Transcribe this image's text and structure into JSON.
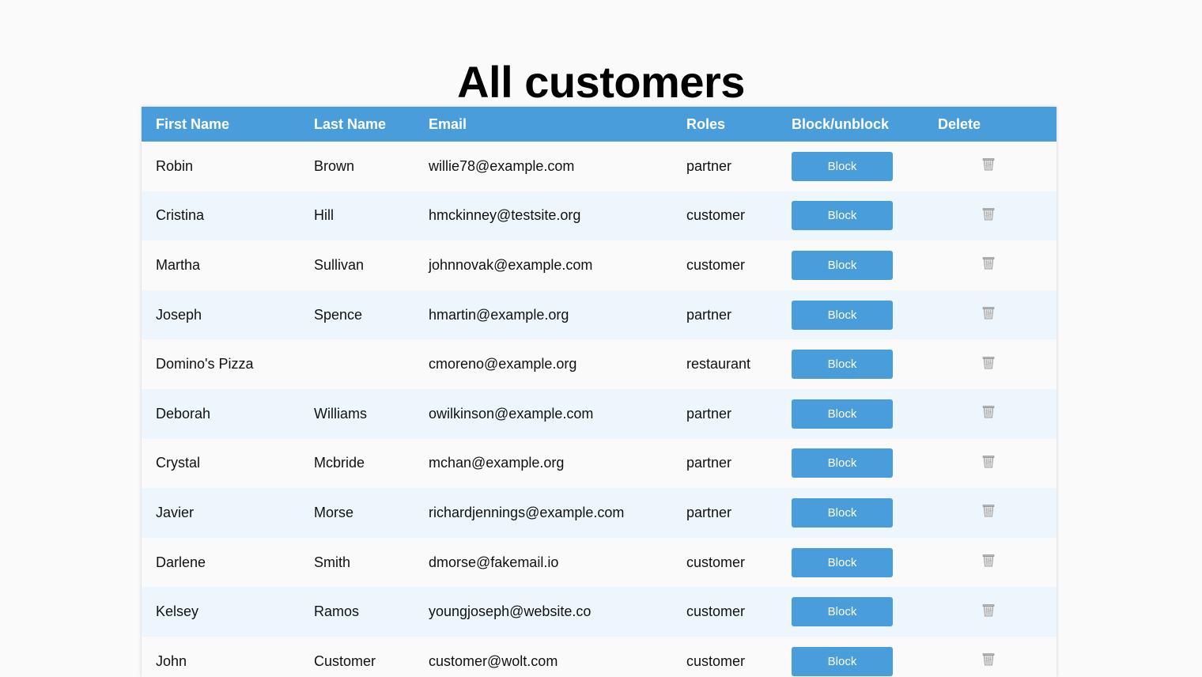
{
  "page": {
    "title": "All customers"
  },
  "table": {
    "headers": {
      "first_name": "First Name",
      "last_name": "Last Name",
      "email": "Email",
      "roles": "Roles",
      "block": "Block/unblock",
      "delete": "Delete"
    },
    "rows": [
      {
        "first_name": "Robin",
        "last_name": "Brown",
        "email": "willie78@example.com",
        "role": "partner",
        "action": "Block"
      },
      {
        "first_name": "Cristina",
        "last_name": "Hill",
        "email": "hmckinney@testsite.org",
        "role": "customer",
        "action": "Block"
      },
      {
        "first_name": "Martha",
        "last_name": "Sullivan",
        "email": "johnnovak@example.com",
        "role": "customer",
        "action": "Block"
      },
      {
        "first_name": "Joseph",
        "last_name": "Spence",
        "email": "hmartin@example.org",
        "role": "partner",
        "action": "Block"
      },
      {
        "first_name": "Domino's Pizza",
        "last_name": "",
        "email": "cmoreno@example.org",
        "role": "restaurant",
        "action": "Block"
      },
      {
        "first_name": "Deborah",
        "last_name": "Williams",
        "email": "owilkinson@example.com",
        "role": "partner",
        "action": "Block"
      },
      {
        "first_name": "Crystal",
        "last_name": "Mcbride",
        "email": "mchan@example.org",
        "role": "partner",
        "action": "Block"
      },
      {
        "first_name": "Javier",
        "last_name": "Morse",
        "email": "richardjennings@example.com",
        "role": "partner",
        "action": "Block"
      },
      {
        "first_name": "Darlene",
        "last_name": "Smith",
        "email": "dmorse@fakemail.io",
        "role": "customer",
        "action": "Block"
      },
      {
        "first_name": "Kelsey",
        "last_name": "Ramos",
        "email": "youngjoseph@website.co",
        "role": "customer",
        "action": "Block"
      },
      {
        "first_name": "John",
        "last_name": "Customer",
        "email": "customer@wolt.com",
        "role": "customer",
        "action": "Block"
      }
    ]
  },
  "icons": {
    "delete": "trash-icon"
  },
  "colors": {
    "accent": "#4a9ddb",
    "row_alt": "#eef6fd",
    "background": "#fafafa"
  }
}
